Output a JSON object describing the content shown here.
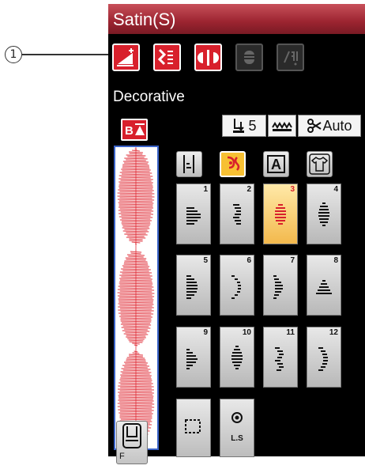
{
  "callout": {
    "number": "1"
  },
  "screen": {
    "title": "Satin(S)",
    "section_label": "Decorative",
    "toolbar_icons": [
      "elongation-icon",
      "mirror-stitch-icon",
      "combination-icon",
      "presser-foot-icon",
      "tension-icon"
    ],
    "settings": {
      "tension_value": "5",
      "auto_label": "Auto"
    },
    "categories": [
      "utility-stitch-icon",
      "decorative-stitch-icon",
      "letter-icon",
      "shirt-icon"
    ],
    "category_letter": "A",
    "stitches": [
      {
        "num": "1"
      },
      {
        "num": "2"
      },
      {
        "num": "3",
        "selected": true
      },
      {
        "num": "4"
      },
      {
        "num": "5"
      },
      {
        "num": "6"
      },
      {
        "num": "7"
      },
      {
        "num": "8"
      },
      {
        "num": "9"
      },
      {
        "num": "10"
      },
      {
        "num": "11"
      },
      {
        "num": "12"
      }
    ],
    "bottom": {
      "ls_label": "L.S",
      "foot_label": "F"
    }
  }
}
